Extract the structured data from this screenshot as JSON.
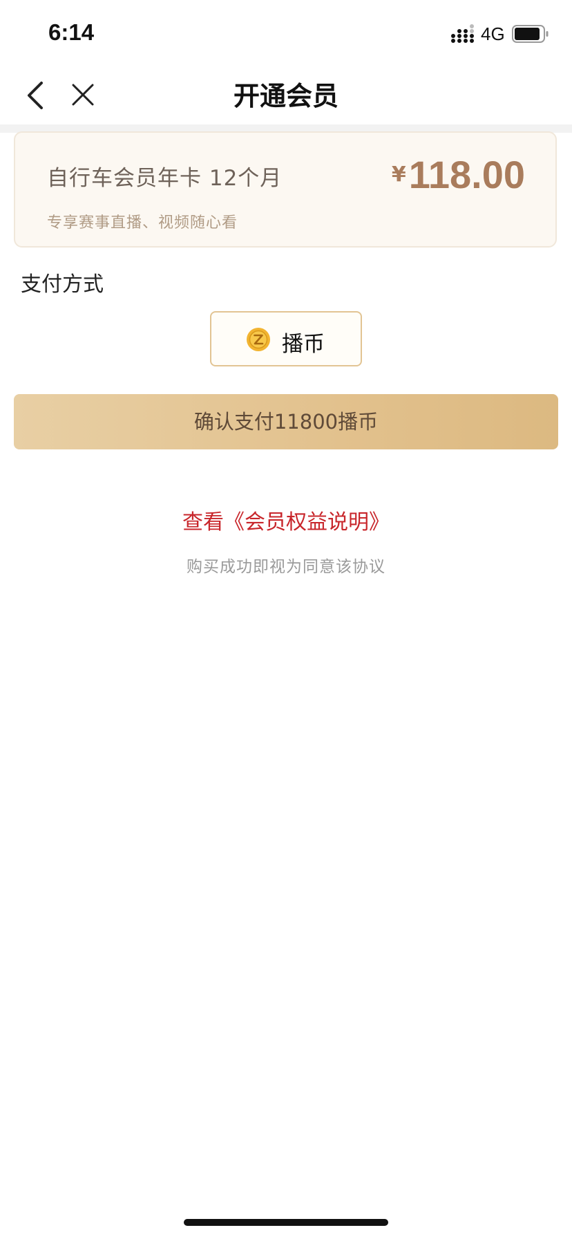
{
  "status_bar": {
    "time": "6:14",
    "network": "4G",
    "signal_icon": "cellular-signal-icon",
    "battery_icon": "battery-icon"
  },
  "nav": {
    "title": "开通会员",
    "back_icon": "chevron-left-icon",
    "close_icon": "close-icon"
  },
  "product": {
    "name": "自行车会员年卡 12个月",
    "description": "专享赛事直播、视频随心看",
    "currency_symbol": "¥",
    "price": "118.00"
  },
  "payment": {
    "section_label": "支付方式",
    "option_label": "播币",
    "option_icon": "coin-icon"
  },
  "confirm": {
    "label": "确认支付11800播币"
  },
  "footer": {
    "benefits_link": "查看《会员权益说明》",
    "agreement_note": "购买成功即视为同意该协议"
  },
  "colors": {
    "price": "#a97c5c",
    "link": "#c8262b",
    "button_gradient_start": "#e8cfa4",
    "button_gradient_end": "#dcb981",
    "card_background": "#fcf8f2"
  }
}
